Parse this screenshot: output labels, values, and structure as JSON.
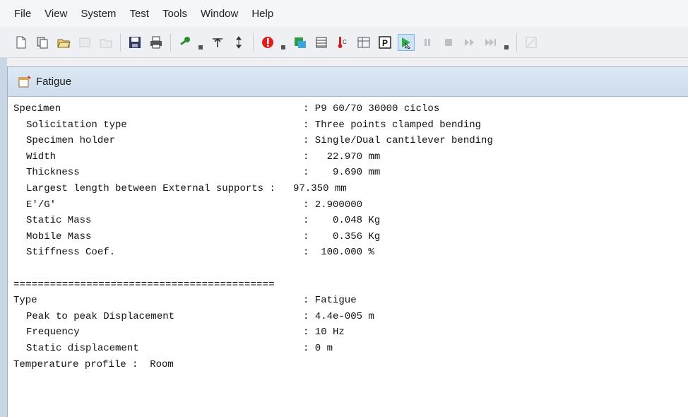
{
  "menu": [
    "File",
    "View",
    "System",
    "Test",
    "Tools",
    "Window",
    "Help"
  ],
  "toolbar": {
    "icons": [
      "new-icon",
      "copy-icon",
      "open-icon",
      "edit-icon",
      "folder-icon",
      "save-icon",
      "print-icon",
      "key-icon",
      "antenna-icon",
      "updown-icon",
      "stop-icon",
      "chart-icon",
      "calendar-icon",
      "thermometer-icon",
      "table-icon",
      "p-icon",
      "run-icon",
      "pause-icon",
      "stop-square-icon",
      "fast-forward-icon",
      "skip-icon",
      "blank-icon"
    ]
  },
  "window": {
    "title": "Fatigue"
  },
  "report": {
    "specimen_key": "Specimen",
    "specimen_val": ": P9 60/70 30000 ciclos",
    "solicitation_key": "Solicitation type",
    "solicitation_val": ": Three points clamped bending",
    "holder_key": "Specimen holder",
    "holder_val": ": Single/Dual cantilever bending",
    "width_key": "Width",
    "width_val": ":   22.970 mm",
    "thickness_key": "Thickness",
    "thickness_val": ":    9.690 mm",
    "length_line": "Largest length between External supports :   97.350 mm",
    "eg_key": "E'/G'",
    "eg_val": ": 2.900000",
    "static_mass_key": "Static Mass",
    "static_mass_val": ":    0.048 Kg",
    "mobile_mass_key": "Mobile Mass",
    "mobile_mass_val": ":    0.356 Kg",
    "stiffness_key": "Stiffness Coef.",
    "stiffness_val": ":  100.000 %",
    "separator": "===========================================",
    "type_key": "Type",
    "type_val": ": Fatigue",
    "p2p_key": "Peak to peak Displacement",
    "p2p_val": ": 4.4e-005 m",
    "freq_key": "Frequency",
    "freq_val": ": 10 Hz",
    "static_disp_key": "Static displacement",
    "static_disp_val": ": 0 m",
    "temp_line": "Temperature profile :  Room"
  }
}
